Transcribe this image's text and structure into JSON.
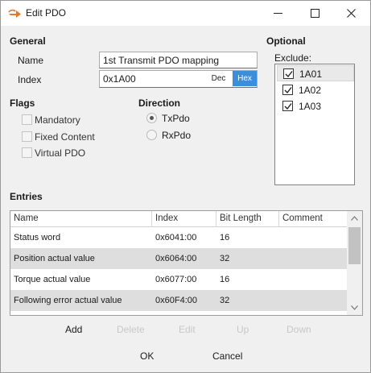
{
  "window": {
    "title": "Edit PDO",
    "accent": "#3c8ed8"
  },
  "general": {
    "heading": "General",
    "name_label": "Name",
    "name_value": "1st Transmit PDO mapping",
    "index_label": "Index",
    "index_value": "0x1A00",
    "dec_label": "Dec",
    "hex_label": "Hex",
    "hex_selected": true
  },
  "optional": {
    "heading": "Optional",
    "exclude_label": "Exclude:",
    "items": [
      {
        "label": "1A01",
        "checked": true,
        "selected": true
      },
      {
        "label": "1A02",
        "checked": true,
        "selected": false
      },
      {
        "label": "1A03",
        "checked": true,
        "selected": false
      }
    ]
  },
  "flags": {
    "heading": "Flags",
    "items": [
      {
        "label": "Mandatory",
        "checked": false,
        "enabled": false
      },
      {
        "label": "Fixed Content",
        "checked": false,
        "enabled": false
      },
      {
        "label": "Virtual PDO",
        "checked": false,
        "enabled": false
      }
    ]
  },
  "direction": {
    "heading": "Direction",
    "options": [
      {
        "label": "TxPdo",
        "selected": true
      },
      {
        "label": "RxPdo",
        "selected": false
      }
    ]
  },
  "entries": {
    "heading": "Entries",
    "columns": [
      "Name",
      "Index",
      "Bit Length",
      "Comment"
    ],
    "rows": [
      {
        "name": "Status word",
        "index": "0x6041:00",
        "bit_length": "16",
        "comment": ""
      },
      {
        "name": "Position actual value",
        "index": "0x6064:00",
        "bit_length": "32",
        "comment": ""
      },
      {
        "name": "Torque actual value",
        "index": "0x6077:00",
        "bit_length": "16",
        "comment": ""
      },
      {
        "name": "Following error actual value",
        "index": "0x60F4:00",
        "bit_length": "32",
        "comment": ""
      }
    ]
  },
  "actions": {
    "add": "Add",
    "delete": "Delete",
    "edit": "Edit",
    "up": "Up",
    "down": "Down"
  },
  "dialog": {
    "ok": "OK",
    "cancel": "Cancel"
  }
}
